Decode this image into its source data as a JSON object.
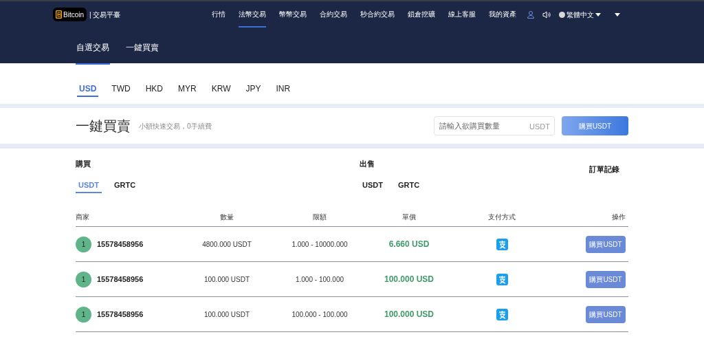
{
  "header": {
    "logo": "Bitcoin",
    "platform": "| 交易平臺",
    "nav": [
      {
        "label": "行情",
        "selected": false
      },
      {
        "label": "法幣交易",
        "selected": true
      },
      {
        "label": "幣幣交易",
        "selected": false
      },
      {
        "label": "合約交易",
        "selected": false
      },
      {
        "label": "秒合約交易",
        "selected": false
      },
      {
        "label": "鎖倉挖礦",
        "selected": false
      },
      {
        "label": "線上客服",
        "selected": false
      },
      {
        "label": "我的資產",
        "selected": false
      }
    ],
    "language": "繁體中文"
  },
  "subtabs": [
    {
      "label": "自選交易",
      "selected": true
    },
    {
      "label": "一鍵買賣",
      "selected": false
    }
  ],
  "currencies": [
    {
      "label": "USD",
      "selected": true
    },
    {
      "label": "TWD",
      "selected": false
    },
    {
      "label": "HKD",
      "selected": false
    },
    {
      "label": "MYR",
      "selected": false
    },
    {
      "label": "KRW",
      "selected": false
    },
    {
      "label": "JPY",
      "selected": false
    },
    {
      "label": "INR",
      "selected": false
    }
  ],
  "quick_trade": {
    "title": "一鍵買賣",
    "subtitle": "小額快速交易，0手續費",
    "amount_field": {
      "placeholder": "請輸入欲購買數量",
      "unit": "USDT"
    },
    "button": "購買USDT"
  },
  "buy": {
    "title": "購買",
    "coins": [
      {
        "label": "USDT",
        "selected": true
      },
      {
        "label": "GRTC",
        "selected": false
      }
    ]
  },
  "sell": {
    "title": "出售",
    "coins": [
      {
        "label": "USDT",
        "selected": false
      },
      {
        "label": "GRTC",
        "selected": false
      }
    ]
  },
  "order_history": "訂單記錄",
  "table": {
    "columns": [
      "商家",
      "數量",
      "限額",
      "單價",
      "支付方式",
      "操作"
    ],
    "rows": [
      {
        "avatar": "1",
        "merchant": "15578458956",
        "quantity": "4800.000 USDT",
        "limit": "1.000 - 10000.000",
        "price": "6.660 USD",
        "action": "購買USDT"
      },
      {
        "avatar": "1",
        "merchant": "15578458956",
        "quantity": "100.000 USDT",
        "limit": "1.000 - 100.000",
        "price": "100.000 USD",
        "action": "購買USDT"
      },
      {
        "avatar": "1",
        "merchant": "15578458956",
        "quantity": "100.000 USDT",
        "limit": "100.000 - 100.000",
        "price": "100.000 USD",
        "action": "購買USDT"
      }
    ]
  }
}
